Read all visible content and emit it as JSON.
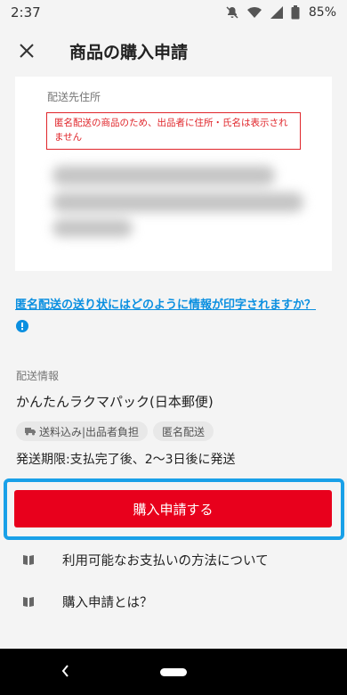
{
  "status_bar": {
    "time": "2:37",
    "battery": "85%",
    "icons": [
      "notifications-off-icon",
      "wifi-icon",
      "signal-icon",
      "battery-icon"
    ]
  },
  "app_bar": {
    "title": "商品の購入申請",
    "close_icon": "close-icon"
  },
  "address": {
    "label": "配送先住所",
    "warning": "匿名配送の商品のため、出品者に住所・氏名は表示されません"
  },
  "help_link": "匿名配送の送り状にはどのように情報が印字されますか？",
  "shipping": {
    "label": "配送情報",
    "method": "かんたんラクマパック(日本郵便)",
    "tags": [
      {
        "icon": "truck-icon",
        "label": "送料込み|出品者負担"
      },
      {
        "icon": "",
        "label": "匿名配送"
      }
    ],
    "deadline": "発送期限:支払完了後、2〜3日後に発送"
  },
  "buy_button": "購入申請する",
  "links": [
    {
      "icon": "book-icon",
      "label": "利用可能なお支払いの方法について"
    },
    {
      "icon": "book-icon",
      "label": "購入申請とは？"
    }
  ],
  "colors": {
    "accent_red": "#e8001c",
    "link_blue": "#0a8fe0",
    "highlight_blue": "#19a0e8"
  }
}
